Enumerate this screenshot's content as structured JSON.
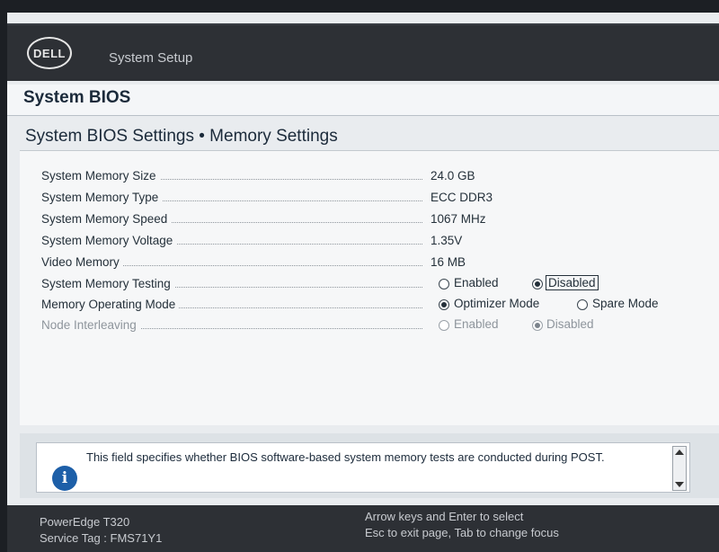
{
  "header": {
    "brand": "DELL",
    "title": "System Setup"
  },
  "page": {
    "title": "System BIOS",
    "section": "System BIOS Settings • Memory Settings"
  },
  "settings": [
    {
      "label": "System Memory Size",
      "value": "24.0 GB"
    },
    {
      "label": "System Memory Type",
      "value": "ECC DDR3"
    },
    {
      "label": "System Memory Speed",
      "value": "1067 MHz"
    },
    {
      "label": "System Memory Voltage",
      "value": "1.35V"
    },
    {
      "label": "Video Memory",
      "value": "16 MB"
    },
    {
      "label": "System Memory Testing",
      "options": [
        "Enabled",
        "Disabled"
      ],
      "selected": "Disabled"
    },
    {
      "label": "Memory Operating Mode",
      "options": [
        "Optimizer Mode",
        "Spare Mode"
      ],
      "selected": "Optimizer Mode"
    },
    {
      "label": "Node Interleaving",
      "options": [
        "Enabled",
        "Disabled"
      ],
      "selected": "Disabled",
      "disabled": true
    }
  ],
  "help": {
    "text": "This field specifies whether BIOS software-based system memory tests are conducted during POST.",
    "icon": "info-icon"
  },
  "footer": {
    "model": "PowerEdge T320",
    "service_tag": "Service Tag : FMS71Y1",
    "hint1": "Arrow keys and Enter to select",
    "hint2": "Esc to exit page, Tab to change focus"
  },
  "colors": {
    "header_bg": "#2d3035",
    "accent": "#1d5fa8"
  }
}
